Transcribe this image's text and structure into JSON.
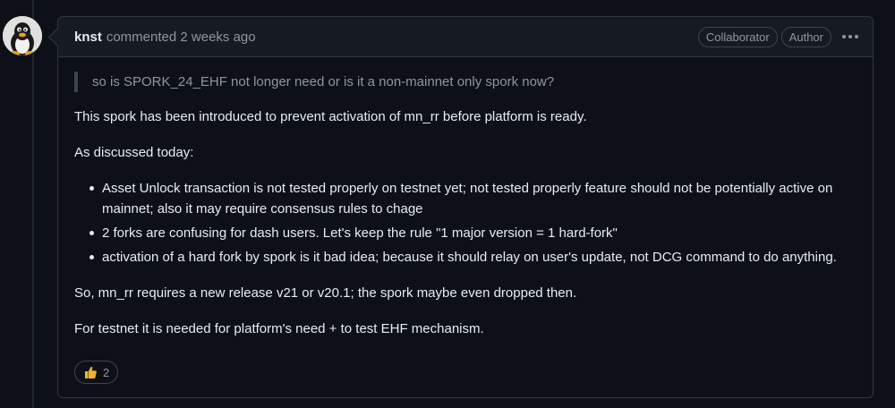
{
  "comment": {
    "author": "knst",
    "meta": "commented 2 weeks ago",
    "badges": [
      "Collaborator",
      "Author"
    ],
    "quote": "so is SPORK_24_EHF not longer need or is it a non-mainnet only spork now?",
    "paragraphs": [
      "This spork has been introduced to prevent activation of mn_rr before platform is ready.",
      "As discussed today:"
    ],
    "bullets": [
      "Asset Unlock transaction is not tested properly on testnet yet; not tested properly feature should not be potentially active on mainnet; also it may require consensus rules to chage",
      "2 forks are confusing for dash users. Let's keep the rule \"1 major version = 1 hard-fork\"",
      "activation of a hard fork by spork is it bad idea; because it should relay on user's update, not DCG command to do anything."
    ],
    "closing": [
      "So, mn_rr requires a new release v21 or v20.1; the spork maybe even dropped then.",
      "For testnet it is needed for platform's need + to test EHF mechanism."
    ],
    "reaction": {
      "icon": "thumbs-up-icon",
      "count": "2"
    }
  }
}
